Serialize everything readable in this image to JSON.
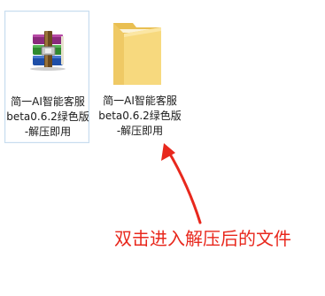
{
  "files": [
    {
      "label_lines": [
        "简一AI智能客服",
        "beta0.6.2绿色版",
        "-解压即用"
      ],
      "icon": "winrar-archive-icon",
      "selected": true
    },
    {
      "label_lines": [
        "简一AI智能客服",
        "beta0.6.2绿色版",
        "-解压即用"
      ],
      "icon": "folder-icon",
      "selected": false
    }
  ],
  "annotation": {
    "text": "双击进入解压后的文件",
    "color": "#e8281d"
  },
  "colors": {
    "selection_border": "#c7dcee",
    "folder": "#f5d77a",
    "annotation": "#e8281d"
  }
}
